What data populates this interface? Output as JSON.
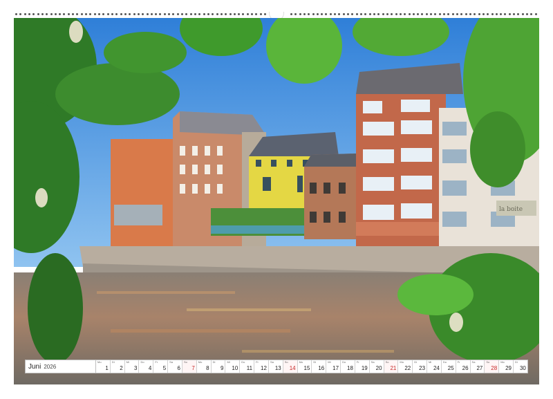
{
  "calendar": {
    "month": "Juni",
    "year": "2026",
    "days": [
      {
        "n": "1",
        "dow": "Mo",
        "type": "weekday"
      },
      {
        "n": "2",
        "dow": "Di",
        "type": "weekday"
      },
      {
        "n": "3",
        "dow": "Mi",
        "type": "weekday"
      },
      {
        "n": "4",
        "dow": "Do",
        "type": "weekday"
      },
      {
        "n": "5",
        "dow": "Fr",
        "type": "weekday"
      },
      {
        "n": "6",
        "dow": "Sa",
        "type": "weekday"
      },
      {
        "n": "7",
        "dow": "So",
        "type": "sunday"
      },
      {
        "n": "8",
        "dow": "Mo",
        "type": "weekday"
      },
      {
        "n": "9",
        "dow": "Di",
        "type": "weekday"
      },
      {
        "n": "10",
        "dow": "Mi",
        "type": "weekday"
      },
      {
        "n": "11",
        "dow": "Do",
        "type": "weekday"
      },
      {
        "n": "12",
        "dow": "Fr",
        "type": "weekday"
      },
      {
        "n": "13",
        "dow": "Sa",
        "type": "weekday"
      },
      {
        "n": "14",
        "dow": "So",
        "type": "sunday"
      },
      {
        "n": "15",
        "dow": "Mo",
        "type": "weekday"
      },
      {
        "n": "16",
        "dow": "Di",
        "type": "weekday"
      },
      {
        "n": "17",
        "dow": "Mi",
        "type": "weekday"
      },
      {
        "n": "18",
        "dow": "Do",
        "type": "weekday"
      },
      {
        "n": "19",
        "dow": "Fr",
        "type": "weekday"
      },
      {
        "n": "20",
        "dow": "Sa",
        "type": "weekday"
      },
      {
        "n": "21",
        "dow": "So",
        "type": "sunday"
      },
      {
        "n": "22",
        "dow": "Mo",
        "type": "weekday"
      },
      {
        "n": "23",
        "dow": "Di",
        "type": "weekday"
      },
      {
        "n": "24",
        "dow": "Mi",
        "type": "weekday"
      },
      {
        "n": "25",
        "dow": "Do",
        "type": "weekday"
      },
      {
        "n": "26",
        "dow": "Fr",
        "type": "weekday"
      },
      {
        "n": "27",
        "dow": "Sa",
        "type": "weekday"
      },
      {
        "n": "28",
        "dow": "So",
        "type": "sunday"
      },
      {
        "n": "29",
        "dow": "Mo",
        "type": "weekday"
      },
      {
        "n": "30",
        "dow": "Di",
        "type": "weekday"
      }
    ]
  },
  "photo": {
    "shop_sign": "la boite"
  },
  "colors": {
    "sky": "#3d8fe0",
    "water": "#a8836a",
    "brick": "#c2684a",
    "yellow_house": "#e4d744",
    "leaves": "#2f7a27",
    "sunday_red": "#c62828"
  }
}
